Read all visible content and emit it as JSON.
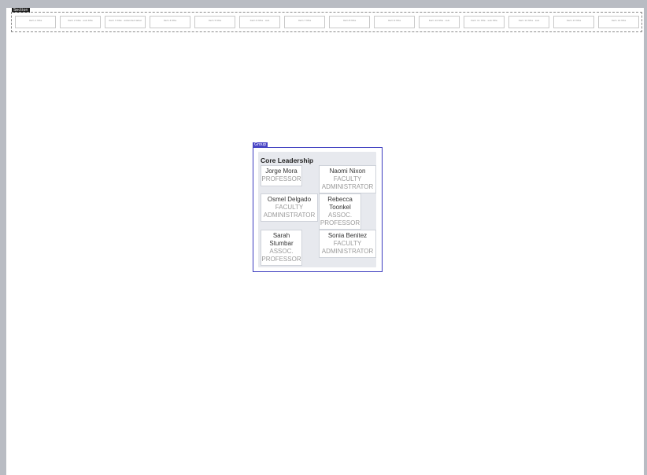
{
  "sections": [
    {
      "tag": "Section",
      "placeholders": [
        "item 1 title",
        "item 2 title · sub title",
        "item 3 title · extended label",
        "item 4 title",
        "item 5 title",
        "item 6 title · sub",
        "item 7 title",
        "item 8 title",
        "item 9 title",
        "item 10 title · sub",
        "item 11 title · sub title",
        "item 12 title · sub",
        "item 13 title",
        "item 14 title"
      ]
    }
  ],
  "group": {
    "tag": "Group",
    "title": "Core Leadership",
    "members": [
      {
        "name": "Jorge Mora",
        "title": "PROFESSOR"
      },
      {
        "name": "Naomi Nixon",
        "title": "FACULTY ADMINISTRATOR"
      },
      {
        "name": "Osmel Delgado",
        "title": "FACULTY ADMINISTRATOR"
      },
      {
        "name": "Rebecca Toonkel",
        "title": "ASSOC. PROFESSOR"
      },
      {
        "name": "Sarah Stumbar",
        "title": "ASSOC. PROFESSOR"
      },
      {
        "name": "Sonia Benitez",
        "title": "FACULTY ADMINISTRATOR"
      }
    ]
  },
  "colors": {
    "canvas": "#b9bcc3",
    "page": "#ffffff",
    "group_border": "#3c3cbf",
    "group_tag": "#4a46c6",
    "group_bg": "#e7e9ee"
  }
}
